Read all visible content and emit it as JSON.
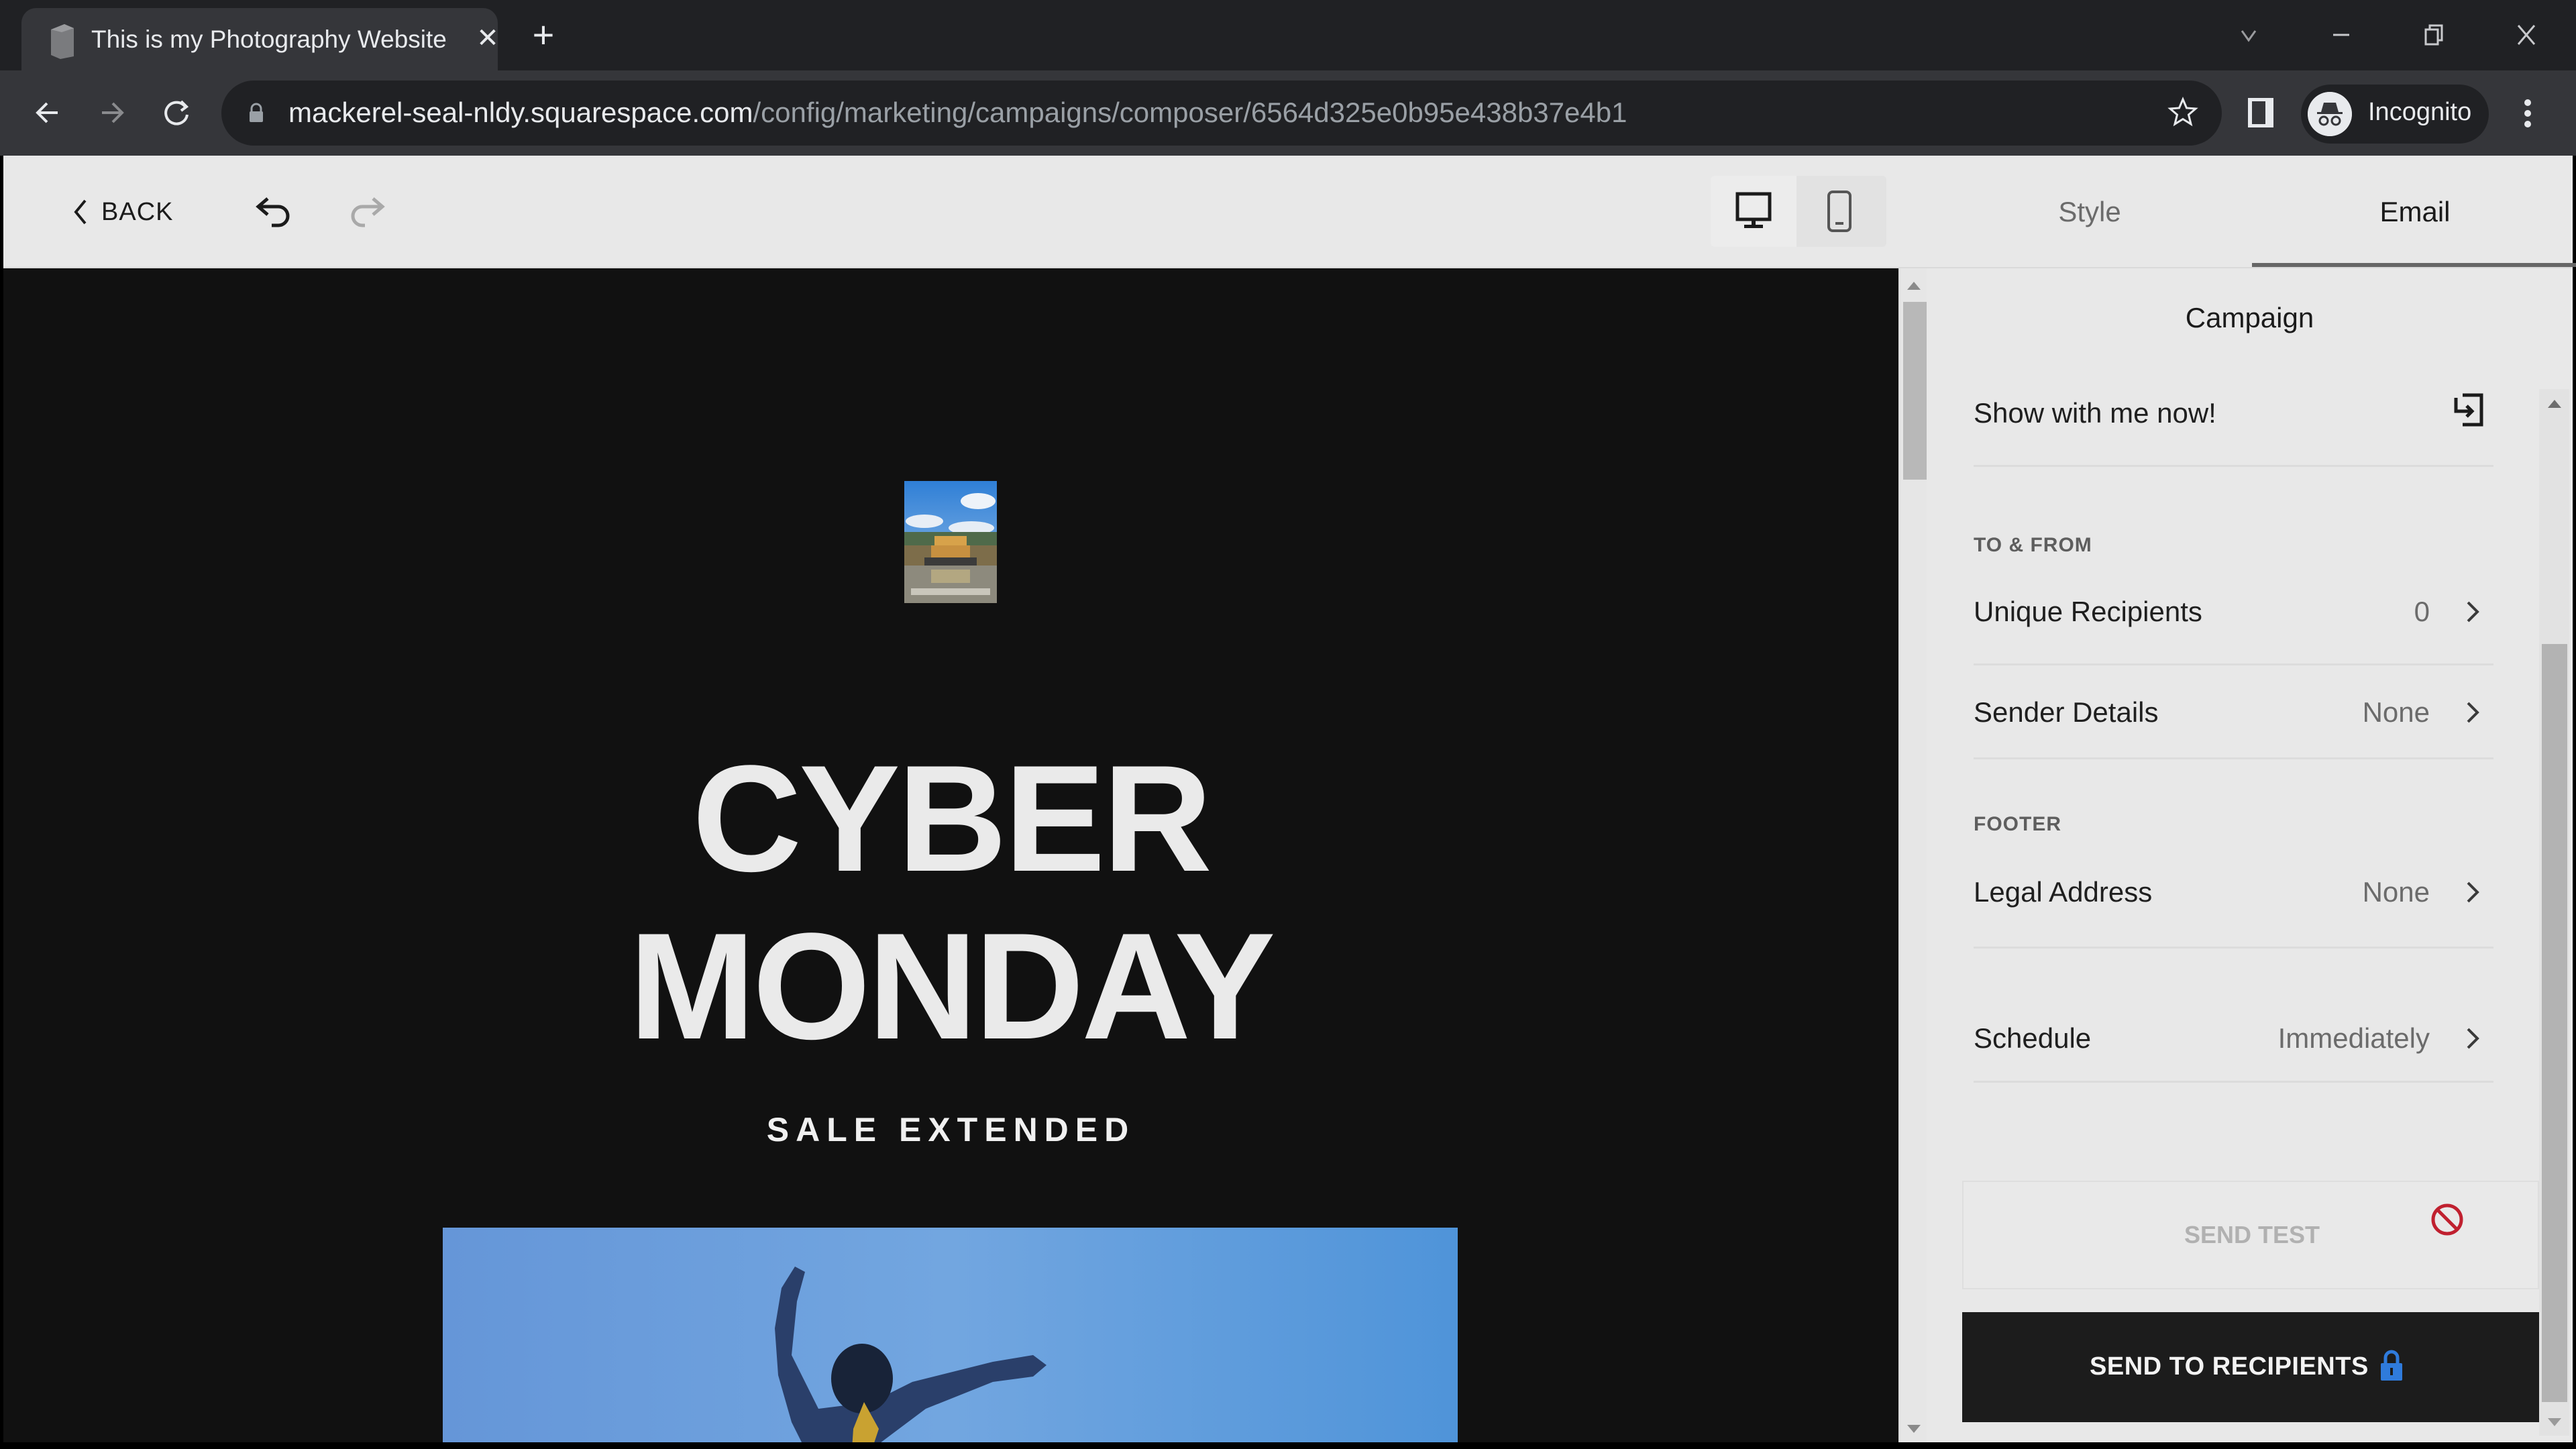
{
  "browser": {
    "tab_title": "This is my Photography Website",
    "url_host": "mackerel-seal-nldy.squarespace.com",
    "url_path": "/config/marketing/campaigns/composer/6564d325e0b95e438b37e4b1",
    "profile_label": "Incognito",
    "icons": {
      "close_tab": "close-icon",
      "new_tab": "plus-icon",
      "tab_search": "chevron-down-icon",
      "minimize": "minimize-icon",
      "restore": "restore-icon",
      "close_window": "close-icon",
      "back": "arrow-left-icon",
      "forward": "arrow-right-icon",
      "reload": "reload-icon",
      "lock": "lock-icon",
      "bookmark": "star-icon",
      "side_panel": "side-panel-icon",
      "incognito": "incognito-icon",
      "menu": "kebab-menu-icon"
    }
  },
  "toolbar": {
    "back_label": "BACK",
    "undo_icon": "undo-icon",
    "redo_icon": "redo-icon",
    "redo_enabled": false,
    "device_modes": [
      {
        "name": "desktop",
        "icon": "desktop-icon",
        "active": true
      },
      {
        "name": "mobile",
        "icon": "mobile-icon",
        "active": false
      }
    ],
    "tabs": [
      {
        "label": "Style",
        "active": false
      },
      {
        "label": "Email",
        "active": true
      }
    ]
  },
  "preview": {
    "logo_alt": "Golden pavilion photo",
    "headline_line1": "CYBER",
    "headline_line2": "MONDAY",
    "subheadline": "SALE EXTENDED",
    "hero_alt": "Dancer against blue sky",
    "background_color": "#111111",
    "headline_color": "#eaeaea"
  },
  "panel": {
    "title": "Campaign",
    "subject": "Show with me now!",
    "subject_icon": "exit-icon",
    "sections": [
      {
        "label": "TO & FROM",
        "rows": [
          {
            "label": "Unique Recipients",
            "value": "0"
          },
          {
            "label": "Sender Details",
            "value": "None"
          }
        ]
      },
      {
        "label": "FOOTER",
        "rows": [
          {
            "label": "Legal Address",
            "value": "None"
          }
        ]
      }
    ],
    "schedule": {
      "label": "Schedule",
      "value": "Immediately"
    },
    "send_test_label": "SEND TEST",
    "send_test_disabled": true,
    "send_test_icon": "not-allowed-icon",
    "send_recipients_label": "SEND TO RECIPIENTS",
    "send_recipients_icon": "lock-icon",
    "colors": {
      "disabled_icon": "#c0202f",
      "lock_icon": "#2f7bdc",
      "primary_button": "#1c1c1c"
    }
  }
}
